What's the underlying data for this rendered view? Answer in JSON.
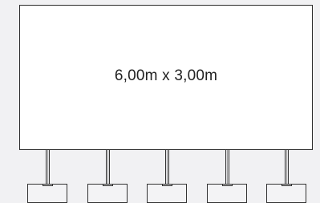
{
  "screen": {
    "dimensions_label": "6,00m x 3,00m"
  },
  "supports": {
    "count": 5
  }
}
